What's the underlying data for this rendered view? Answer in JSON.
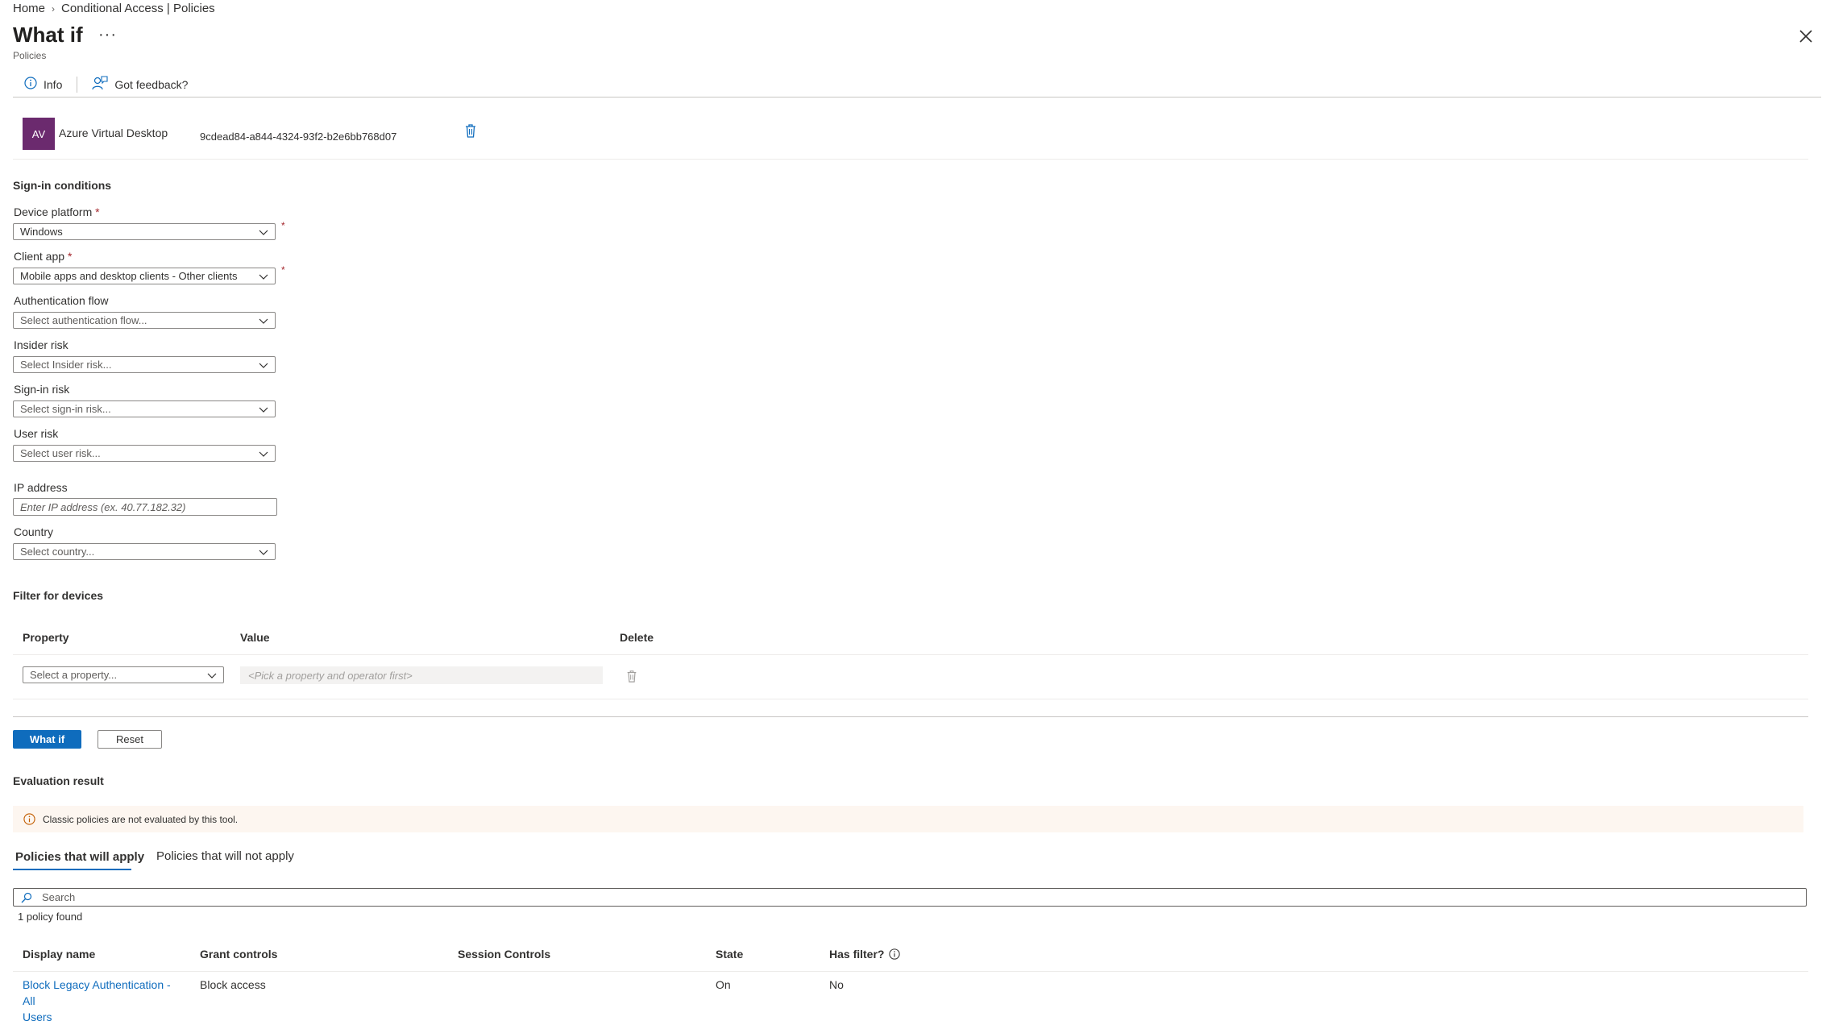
{
  "breadcrumb": [
    "Home",
    "Conditional Access | Policies"
  ],
  "page": {
    "title": "What if",
    "more": "···",
    "subtitle": "Policies"
  },
  "toolbar": {
    "info": "Info",
    "feedback": "Got feedback?"
  },
  "app": {
    "avatar": "AV",
    "name": "Azure Virtual Desktop",
    "id": "9cdead84-a844-4324-93f2-b2e6bb768d07"
  },
  "sign_in": {
    "heading": "Sign-in conditions",
    "device_platform": {
      "label": "Device platform",
      "value": "Windows"
    },
    "client_app": {
      "label": "Client app",
      "value": "Mobile apps and desktop clients - Other clients"
    },
    "auth_flow": {
      "label": "Authentication flow",
      "placeholder": "Select authentication flow..."
    },
    "insider_risk": {
      "label": "Insider risk",
      "placeholder": "Select Insider risk..."
    },
    "sign_in_risk": {
      "label": "Sign-in risk",
      "placeholder": "Select sign-in risk..."
    },
    "user_risk": {
      "label": "User risk",
      "placeholder": "Select user risk..."
    },
    "ip": {
      "label": "IP address",
      "placeholder": "Enter IP address (ex. 40.77.182.32)"
    },
    "country": {
      "label": "Country",
      "placeholder": "Select country..."
    },
    "required_mark": "*"
  },
  "filter": {
    "heading": "Filter for devices",
    "columns": [
      "Property",
      "Value",
      "Delete"
    ],
    "property_placeholder": "Select a property...",
    "value_placeholder": "<Pick a property and operator first>"
  },
  "buttons": {
    "what_if": "What if",
    "reset": "Reset"
  },
  "evaluation": {
    "heading": "Evaluation result",
    "notice": "Classic policies are not evaluated by this tool.",
    "tabs": [
      "Policies that will apply",
      "Policies that will not apply"
    ],
    "search_placeholder": "Search",
    "count": "1 policy found",
    "columns": [
      "Display name",
      "Grant controls",
      "Session Controls",
      "State",
      "Has filter?"
    ],
    "rows": [
      {
        "name_line1": "Block Legacy Authentication - All",
        "name_line2": "Users",
        "grant": "Block access",
        "session": "",
        "state": "On",
        "has_filter": "No"
      }
    ]
  },
  "colors": {
    "accent": "#0f6cbd",
    "avatar": "#6b2a6e",
    "notice_bg": "#fdf6f0",
    "required": "#a4262c"
  }
}
